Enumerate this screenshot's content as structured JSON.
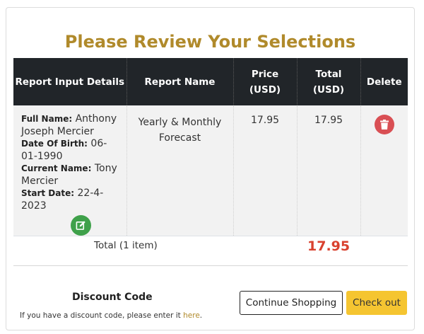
{
  "page_title": "Please Review Your Selections",
  "table": {
    "headers": {
      "details": "Report Input Details",
      "report_name": "Report Name",
      "price_line1": "Price",
      "price_line2": "(USD)",
      "total_line1": "Total",
      "total_line2": "(USD)",
      "delete": "Delete"
    },
    "row": {
      "full_name_label": "Full Name:",
      "full_name_value": "Anthony Joseph Mercier",
      "dob_label": "Date Of Birth:",
      "dob_value": "06-01-1990",
      "current_name_label": "Current Name:",
      "current_name_value": "Tony Mercier",
      "start_date_label": "Start Date:",
      "start_date_value": "22-4-2023",
      "report_name": "Yearly & Monthly Forecast",
      "price": "17.95",
      "total": "17.95"
    }
  },
  "summary": {
    "total_label": "Total (1 item)",
    "total_value": "17.95"
  },
  "discount": {
    "title": "Discount Code",
    "note": "If you have a discount code, please enter it",
    "link": "here",
    "note_end": "."
  },
  "buttons": {
    "continue": "Continue Shopping",
    "checkout": "Check out"
  },
  "colors": {
    "title": "#b08a2b",
    "header_bg": "#212529",
    "edit": "#3fa14a",
    "delete": "#d94f54",
    "total": "#d9412e",
    "checkout": "#f5c531"
  },
  "icons": {
    "edit": "edit-icon",
    "delete": "trash-icon"
  }
}
